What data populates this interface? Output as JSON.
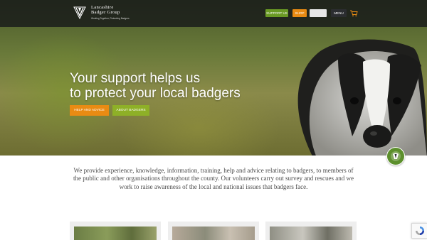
{
  "header": {
    "logo_name_line1": "Lancashire",
    "logo_name_line2": "Badger Group",
    "logo_tagline": "Working Together, Protecting Badgers",
    "nav": {
      "support_label": "SUPPORT US",
      "shop_label": "SHOP",
      "menu_label": "MENU"
    },
    "cart_icon": "cart-icon"
  },
  "hero": {
    "title_line1": "Your support helps us",
    "title_line2": "to protect your local badgers",
    "cta_help_label": "HELP AND ADVICE",
    "cta_about_label": "ABOUT BADGERS"
  },
  "intro": {
    "text": "We provide experience, knowledge, information, training, help and advice relating to badgers, to members of the public and other organisations throughout the county. Our volunteers carry out survey and rescues and we work to raise awareness of the local and national issues that badgers face."
  },
  "colors": {
    "green": "#6a9a24",
    "orange": "#e98b13",
    "lime": "#8eb027",
    "dark": "#2b2d30"
  }
}
